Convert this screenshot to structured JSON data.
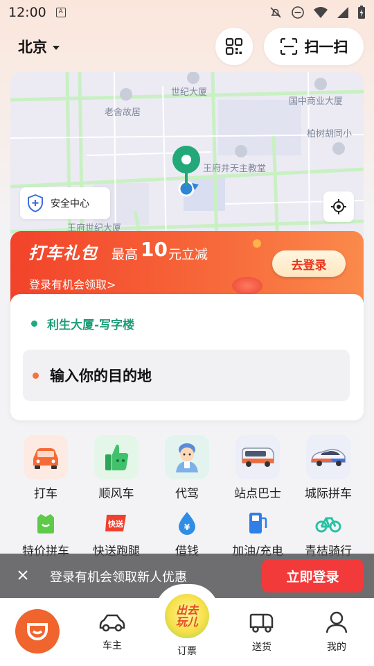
{
  "status_bar": {
    "time": "12:00"
  },
  "header": {
    "city": "北京",
    "scan_label": "扫一扫"
  },
  "map": {
    "labels": [
      "世纪大厦",
      "国中商业大厦",
      "老舍故居",
      "柏树胡同小",
      "王府井天主教堂",
      "王府世纪大厦"
    ],
    "safety_label": "安全中心"
  },
  "promo": {
    "title": "打车礼包",
    "prefix": "最高",
    "amount": "10",
    "suffix": "元立减",
    "desc": "登录有机会领取>",
    "button": "去登录"
  },
  "trip": {
    "from": "利生大厦-写字楼",
    "to_placeholder": "输入你的目的地"
  },
  "services_main": [
    {
      "label": "打车",
      "icon": "taxi-car-icon"
    },
    {
      "label": "顺风车",
      "icon": "thumbs-up-icon"
    },
    {
      "label": "代驾",
      "icon": "driver-icon"
    },
    {
      "label": "站点巴士",
      "icon": "bus-icon"
    },
    {
      "label": "城际拼车",
      "icon": "intercity-car-icon"
    }
  ],
  "services_secondary": [
    {
      "label": "特价拼车",
      "icon": "discount-carpool-icon"
    },
    {
      "label": "快送跑腿",
      "icon": "express-delivery-icon"
    },
    {
      "label": "借钱",
      "icon": "loan-icon"
    },
    {
      "label": "加油/充电",
      "icon": "fuel-charge-icon"
    },
    {
      "label": "青桔骑行",
      "icon": "bike-icon"
    }
  ],
  "toast": {
    "message": "登录有机会领取新人优惠",
    "button": "立即登录"
  },
  "bottom_nav": {
    "items": [
      {
        "label": "车主",
        "icon": "car-owner-icon"
      },
      {
        "label": "订票",
        "icon": "ticket-badge-icon"
      },
      {
        "label": "送货",
        "icon": "truck-icon"
      },
      {
        "label": "我的",
        "icon": "profile-icon"
      }
    ],
    "center_badge": {
      "line1": "出去",
      "line2": "玩儿"
    }
  },
  "colors": {
    "brand_orange": "#f0642d",
    "promo_red": "#f2432a",
    "pickup_green": "#25a882",
    "toast_button": "#f23a3a"
  }
}
